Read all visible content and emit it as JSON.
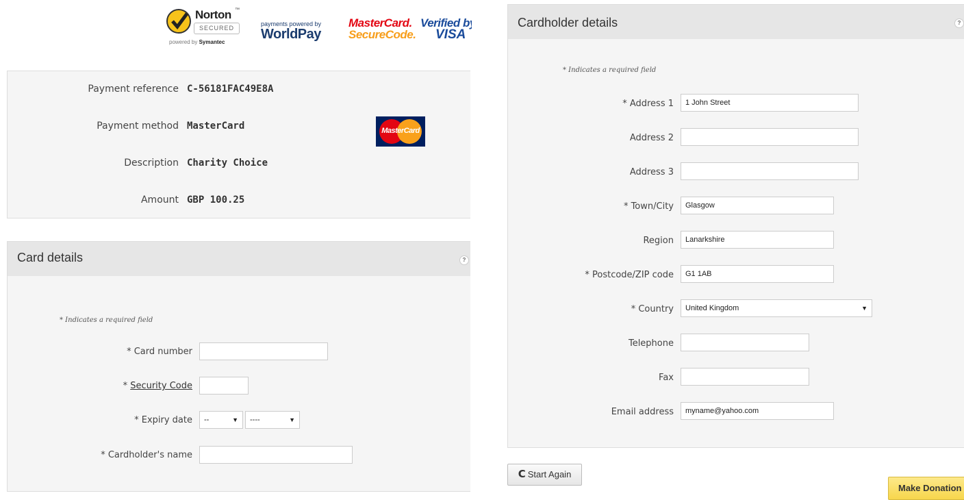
{
  "logos": {
    "norton": {
      "name": "Norton",
      "secured": "SECURED",
      "powered_prefix": "powered by",
      "powered_brand": "Symantec"
    },
    "worldpay": {
      "line1": "payments powered by",
      "line2": "WorldPay"
    },
    "mastercard_securecode": {
      "line1": "MasterCard.",
      "line2": "SecureCode."
    },
    "verified_by_visa": {
      "line1": "Verified by",
      "line2": "VISA"
    }
  },
  "summary": {
    "rows": [
      {
        "label": "Payment reference",
        "value": "C-56181FAC49E8A"
      },
      {
        "label": "Payment method",
        "value": "MasterCard"
      },
      {
        "label": "Description",
        "value": "Charity Choice"
      },
      {
        "label": "Amount",
        "value": "GBP 100.25"
      }
    ],
    "card_logo_text": "MasterCard"
  },
  "card_details": {
    "title": "Card details",
    "help": "?",
    "required_note": "* Indicates a required field",
    "fields": {
      "card_number": {
        "label": "* Card number",
        "value": ""
      },
      "security_code": {
        "prefix": "* ",
        "label": "Security Code",
        "value": ""
      },
      "expiry": {
        "label": "* Expiry date",
        "month": "--",
        "year": "----"
      },
      "cardholder_name": {
        "label": "* Cardholder's name",
        "value": ""
      }
    }
  },
  "cardholder_details": {
    "title": "Cardholder details",
    "help": "?",
    "required_note": "* Indicates a required field",
    "fields": {
      "address1": {
        "label": "* Address 1",
        "value": "1 John Street"
      },
      "address2": {
        "label": "Address 2",
        "value": ""
      },
      "address3": {
        "label": "Address 3",
        "value": ""
      },
      "town": {
        "label": "* Town/City",
        "value": "Glasgow"
      },
      "region": {
        "label": "Region",
        "value": "Lanarkshire"
      },
      "postcode": {
        "label": "* Postcode/ZIP code",
        "value": "G1 1AB"
      },
      "country": {
        "label": "* Country",
        "value": "United Kingdom"
      },
      "telephone": {
        "label": "Telephone",
        "value": ""
      },
      "fax": {
        "label": "Fax",
        "value": ""
      },
      "email": {
        "label": "Email address",
        "value": "myname@yahoo.com"
      }
    }
  },
  "buttons": {
    "start_again_icon": "C",
    "start_again": "Start Again",
    "make_donation": "Make Donation"
  },
  "colors": {
    "panel_bg": "#f5f5f5",
    "panel_header_bg": "#e6e6e6",
    "donate_button": "#f7d64c",
    "mastercard_red": "#e30613",
    "mastercard_orange": "#f9a11b"
  }
}
